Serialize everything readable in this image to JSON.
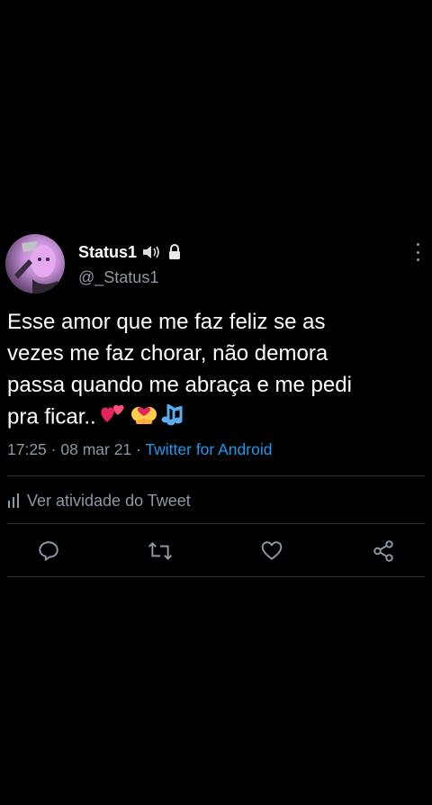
{
  "tweet": {
    "display_name": "Status1",
    "handle": "@_Status1",
    "icons": [
      "speaker-icon",
      "lock-icon"
    ],
    "text_lines": [
      "Esse amor que me faz feliz se as",
      "vezes me faz chorar, não demora",
      "passa quando me abraça e me pedi",
      "pra ficar.."
    ],
    "emojis": [
      "two-hearts-icon",
      "couple-hearts-icon",
      "music-notes-icon"
    ],
    "time": "17:25",
    "date": "08 mar 21",
    "separator": "·",
    "source": "Twitter for Android",
    "activity_label": "Ver atividade do Tweet"
  },
  "colors": {
    "background": "#000000",
    "text": "#ffffff",
    "muted": "#8b98a5",
    "link": "#1d9bf0",
    "divider": "#2f3336"
  }
}
